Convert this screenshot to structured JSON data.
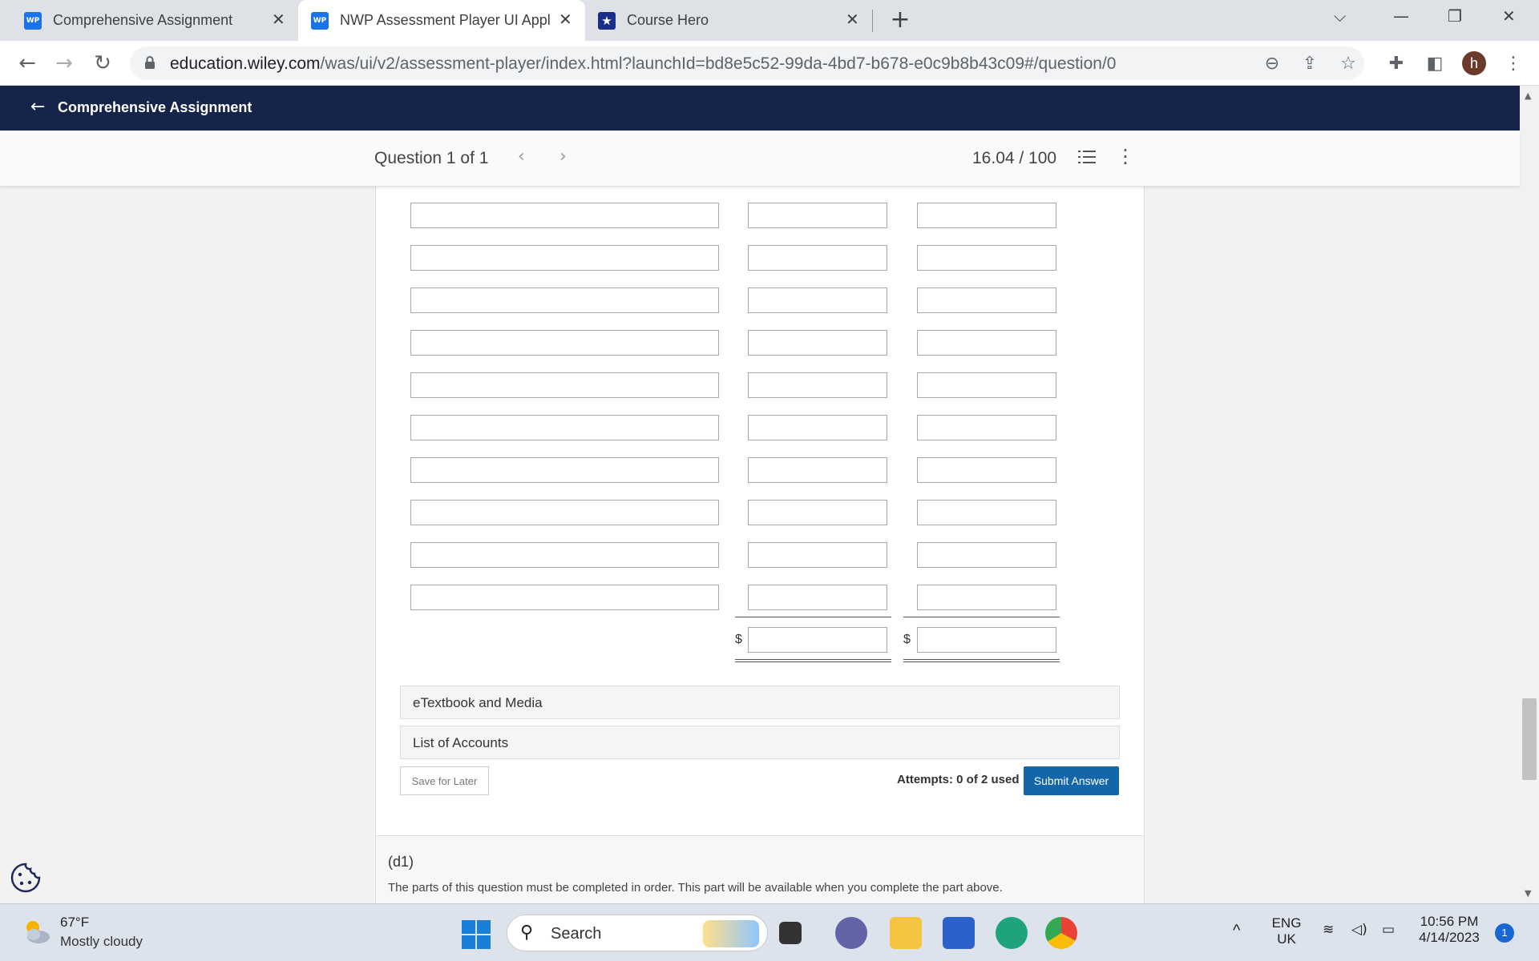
{
  "browser": {
    "tabs": [
      {
        "favicon": "WP",
        "title": "Comprehensive Assignment",
        "active": false
      },
      {
        "favicon": "WP",
        "title": "NWP Assessment Player UI Appli",
        "active": true
      },
      {
        "favicon": "star",
        "title": "Course Hero",
        "active": false
      }
    ],
    "url_host": "education.wiley.com",
    "url_path": "/was/ui/v2/assessment-player/index.html?launchId=bd8e5c52-99da-4bd7-b678-e0c9b8b43c09#/question/0",
    "profile_initial": "h"
  },
  "app": {
    "header_title": "Comprehensive Assignment",
    "question_label": "Question 1 of 1",
    "score": "16.04 / 100"
  },
  "form": {
    "currency_symbol_1": "$",
    "currency_symbol_2": "$"
  },
  "resources": {
    "etextbook_label": "eTextbook and Media",
    "accounts_label": "List of Accounts"
  },
  "actions": {
    "save_label": "Save for Later",
    "attempts_text": "Attempts: 0 of 2 used",
    "submit_label": "Submit Answer"
  },
  "next_part": {
    "title": "(d1)",
    "description": "The parts of this question must be completed in order. This part will be available when you complete the part above."
  },
  "taskbar": {
    "weather_temp": "67°F",
    "weather_desc": "Mostly cloudy",
    "search_label": "Search",
    "language_line1": "ENG",
    "language_line2": "UK",
    "time": "10:56 PM",
    "date": "4/14/2023",
    "notification_count": "1"
  },
  "colors": {
    "app_header": "#16244a",
    "submit_button": "#1366a8",
    "tab_strip": "#dee1e6"
  }
}
